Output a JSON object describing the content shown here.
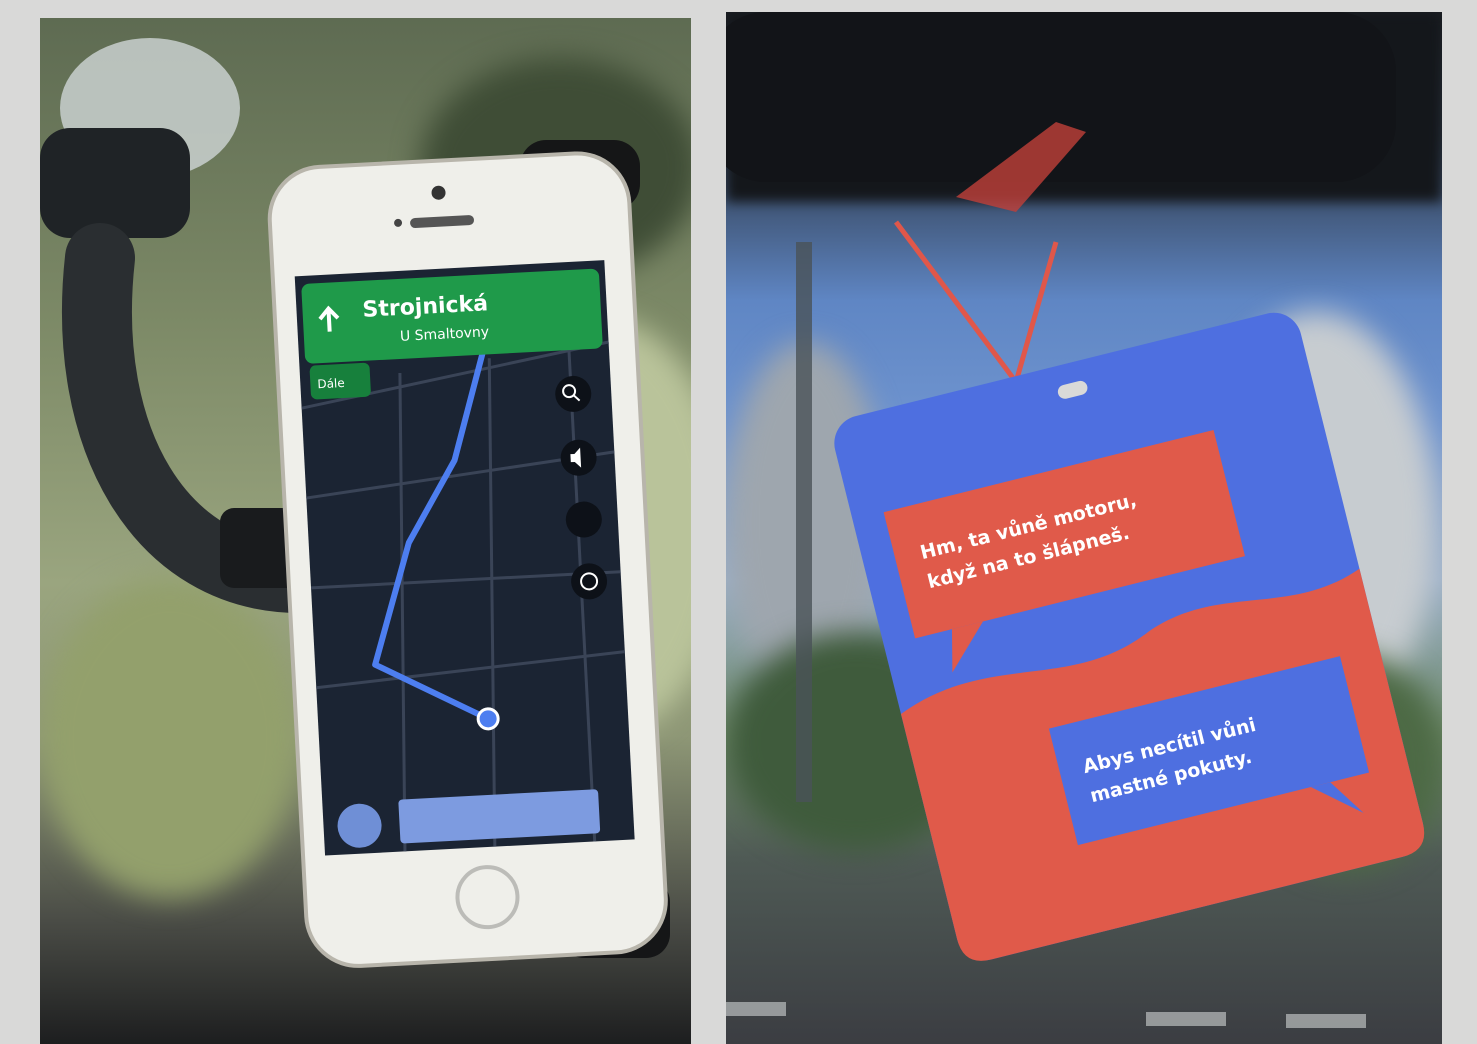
{
  "scene": {
    "left_photo": "phone-navigation",
    "right_photo": "air-freshener-tag"
  },
  "navigation": {
    "street": "Strojnická",
    "next_street": "U Smaltovny",
    "then_label": "Dále",
    "search_icon": "search-icon",
    "sound_icon": "volume-icon",
    "report_icon": "report-icon"
  },
  "tag": {
    "bubble_top_line1": "Hm, ta vůně motoru,",
    "bubble_top_line2": "když na to šlápneš.",
    "bubble_bottom_line1": "Abys necítil vůni",
    "bubble_bottom_line2": "mastné pokuty."
  },
  "colors": {
    "tag_blue": "#4e6fe0",
    "tag_red": "#e05a4a",
    "nav_green": "#1f9a4a",
    "map_bg": "#1b2433",
    "route_blue": "#4d7ef0"
  }
}
